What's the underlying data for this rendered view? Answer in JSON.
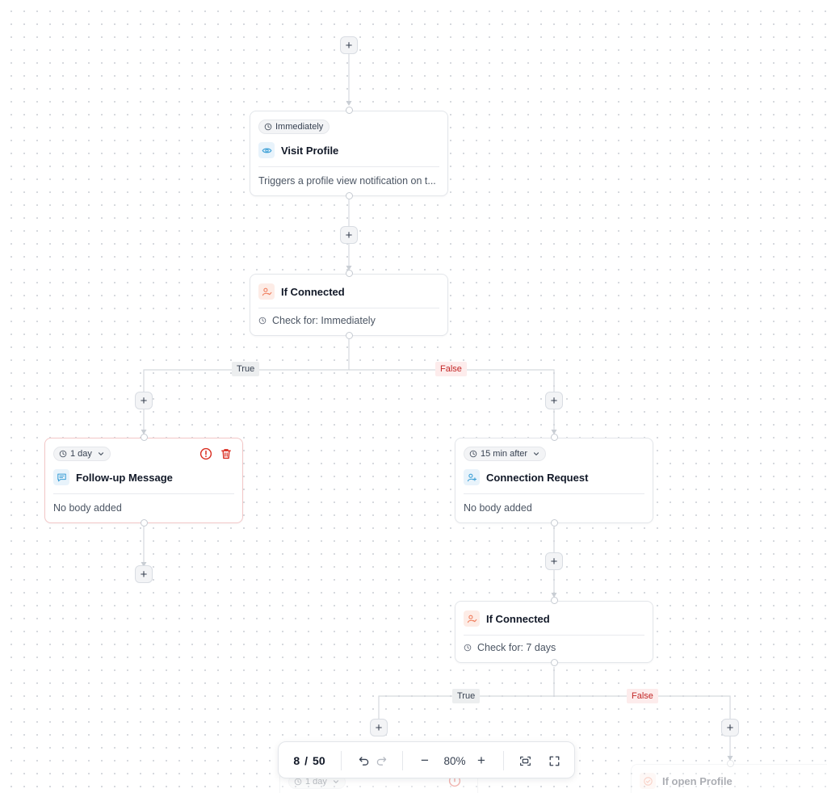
{
  "add_button_symbol": "+",
  "nodes": {
    "visit_profile": {
      "delay": "Immediately",
      "title": "Visit Profile",
      "icon": "eye-icon",
      "description": "Triggers a profile view notification on t..."
    },
    "if_connected_1": {
      "title": "If Connected",
      "icon": "user-check-icon",
      "check": "Check for: Immediately"
    },
    "follow_up": {
      "delay": "1 day",
      "title": "Follow-up Message",
      "icon": "message-icon",
      "body": "No body added",
      "status": "error"
    },
    "connection_request": {
      "delay": "15 min after",
      "title": "Connection Request",
      "icon": "user-plus-icon",
      "body": "No body added"
    },
    "if_connected_2": {
      "title": "If Connected",
      "icon": "user-check-icon",
      "check": "Check for: 7 days"
    },
    "partial_left": {
      "delay": "1 day"
    },
    "if_open_profile": {
      "title": "If open Profile",
      "icon": "user-check-icon"
    }
  },
  "branches": {
    "b1_true": "True",
    "b1_false": "False",
    "b2_true": "True",
    "b2_false": "False"
  },
  "toolbar": {
    "counter_current": "8",
    "counter_separator": "/",
    "counter_total": "50",
    "zoom": "80%",
    "zoom_out": "−",
    "zoom_in": "+"
  },
  "colors": {
    "accent_blue": "#3a9fd6",
    "accent_orange": "#ef7a59",
    "error_red": "#d92d20",
    "true_bg": "#eceeef",
    "false_bg": "#fdecec"
  }
}
